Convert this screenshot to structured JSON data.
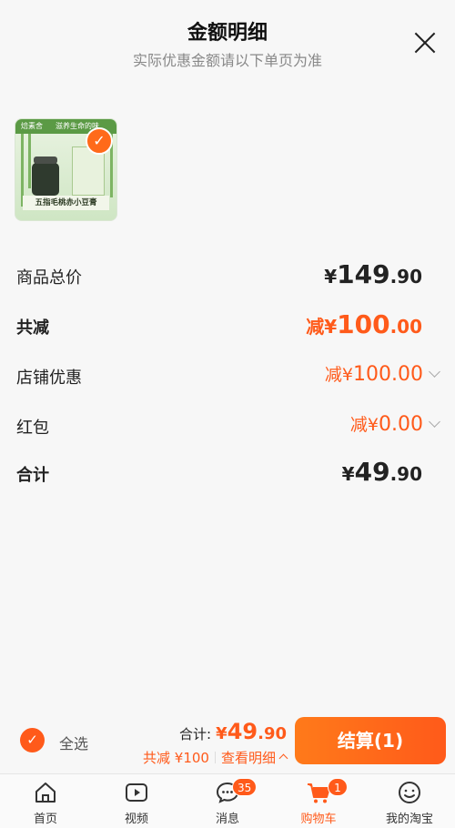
{
  "header": {
    "title": "金额明细",
    "subtitle": "实际优惠金额请以下单页为准"
  },
  "product": {
    "thumb_brand": "焙素舍",
    "thumb_tagline": "滋养生命的味",
    "thumb_banner": "五指毛桃赤小豆膏"
  },
  "rows": {
    "total": {
      "label": "商品总价",
      "currency": "¥",
      "int": "149",
      "dec": ".90"
    },
    "reduce": {
      "label": "共减",
      "prefix": "减",
      "currency": "¥",
      "int": "100",
      "dec": ".00"
    },
    "store": {
      "label": "店铺优惠",
      "prefix": "减",
      "currency": "¥",
      "int": "100",
      "dec": ".00"
    },
    "redpack": {
      "label": "红包",
      "prefix": "减",
      "currency": "¥",
      "int": "0",
      "dec": ".00"
    },
    "sum": {
      "label": "合计",
      "currency": "¥",
      "int": "49",
      "dec": ".90"
    }
  },
  "bottom": {
    "select_all": "全选",
    "sum_label": "合计:",
    "sum_currency": "¥",
    "sum_int": "49",
    "sum_dec": ".90",
    "discount": "共减 ¥100",
    "detail": "查看明细",
    "checkout": "结算(1)"
  },
  "tabs": [
    {
      "label": "首页",
      "icon": "home-icon"
    },
    {
      "label": "视频",
      "icon": "video-icon"
    },
    {
      "label": "消息",
      "icon": "message-icon",
      "badge": "35"
    },
    {
      "label": "购物车",
      "icon": "cart-icon",
      "badge": "1",
      "active": true
    },
    {
      "label": "我的淘宝",
      "icon": "profile-icon"
    }
  ],
  "colors": {
    "accent": "#ff5a1a"
  }
}
